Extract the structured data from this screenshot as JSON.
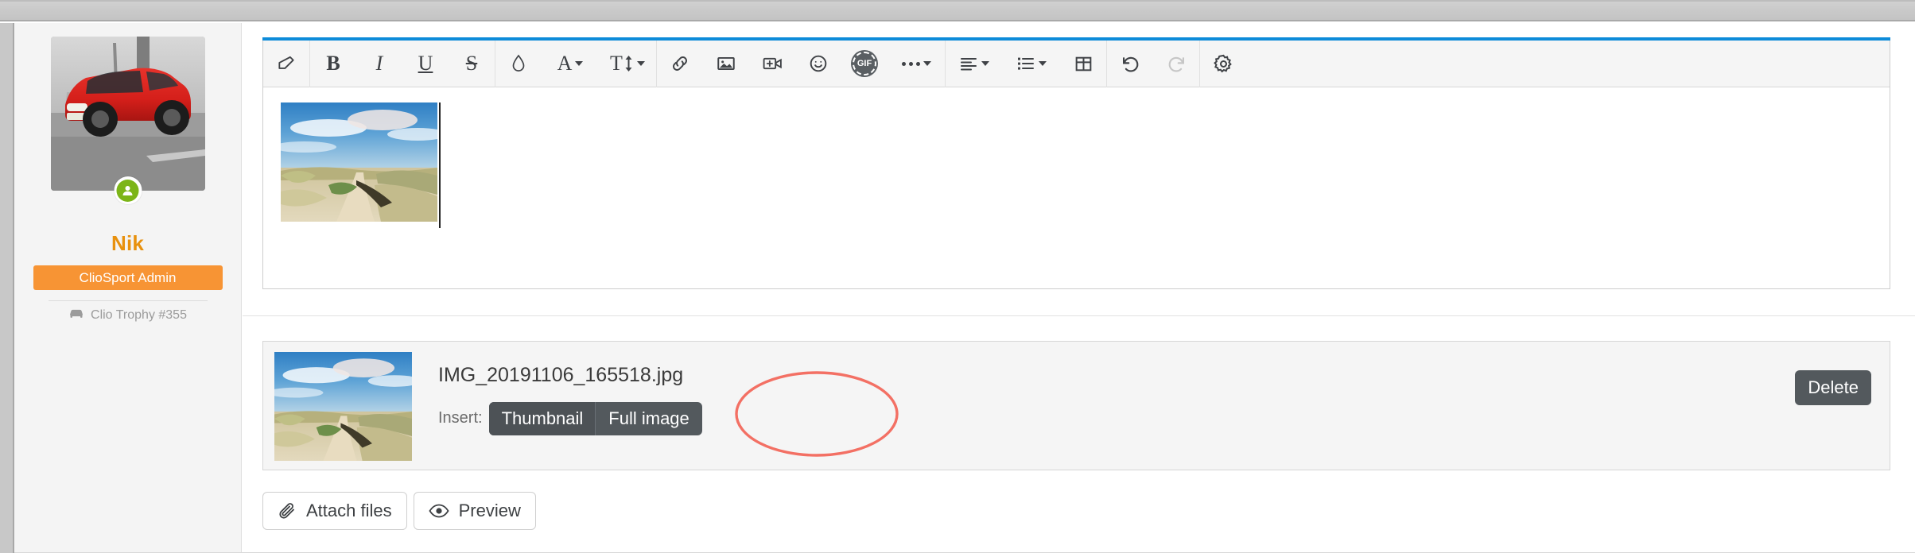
{
  "window": {
    "chrome_bar": ""
  },
  "sidebar": {
    "avatar_alt": "red-clio-car-photo",
    "status_icon": "user-online-icon",
    "username": "Nik",
    "role_badge": "ClioSport Admin",
    "car_icon": "car-icon",
    "car_text": "Clio Trophy #355"
  },
  "editor": {
    "accent_color": "#0d8bd9",
    "toolbar": {
      "groups": [
        {
          "buttons": [
            {
              "name": "remove-format-icon",
              "label": ""
            }
          ]
        },
        {
          "buttons": [
            {
              "name": "bold-icon",
              "label": "B"
            },
            {
              "name": "italic-icon",
              "label": "I"
            },
            {
              "name": "underline-icon",
              "label": "U"
            },
            {
              "name": "strikethrough-icon",
              "label": "S"
            }
          ]
        },
        {
          "buttons": [
            {
              "name": "text-color-icon",
              "label": ""
            },
            {
              "name": "font-family-icon",
              "label": "A"
            },
            {
              "name": "font-size-icon",
              "label": "T"
            }
          ]
        },
        {
          "buttons": [
            {
              "name": "link-icon",
              "label": ""
            },
            {
              "name": "insert-image-icon",
              "label": ""
            },
            {
              "name": "insert-video-icon",
              "label": ""
            },
            {
              "name": "emoji-icon",
              "label": ""
            },
            {
              "name": "gif-icon",
              "label": "GIF"
            },
            {
              "name": "more-options-icon",
              "label": ""
            }
          ]
        },
        {
          "buttons": [
            {
              "name": "text-align-icon",
              "label": ""
            },
            {
              "name": "bullet-list-icon",
              "label": ""
            },
            {
              "name": "insert-table-icon",
              "label": ""
            }
          ]
        },
        {
          "buttons": [
            {
              "name": "undo-icon",
              "label": ""
            },
            {
              "name": "redo-icon",
              "label": ""
            }
          ]
        },
        {
          "buttons": [
            {
              "name": "settings-gear-icon",
              "label": ""
            }
          ]
        }
      ]
    },
    "body": {
      "inserted_image_alt": "sand-dune-path-photo",
      "caret_visible": "true"
    }
  },
  "attachment": {
    "thumbnail_alt": "sand-dune-path-thumbnail",
    "filename": "IMG_20191106_165518.jpg",
    "insert_label": "Insert:",
    "insert_options": [
      {
        "label": "Thumbnail",
        "selected": "true"
      },
      {
        "label": "Full image",
        "selected": "false"
      }
    ],
    "delete_label": "Delete"
  },
  "annotation": {
    "shape": "ellipse",
    "color": "#f2685c",
    "stroke_width": "3"
  },
  "actions": {
    "attach_files": {
      "label": "Attach files",
      "icon": "paperclip-icon"
    },
    "preview": {
      "label": "Preview",
      "icon": "eye-icon"
    }
  },
  "colors": {
    "accent_blue": "#0d8bd9",
    "brand_orange": "#f79434",
    "username_orange": "#e8910e",
    "status_green": "#7cb518",
    "dark_button": "#53595d",
    "annotation_red": "#f2685c"
  }
}
